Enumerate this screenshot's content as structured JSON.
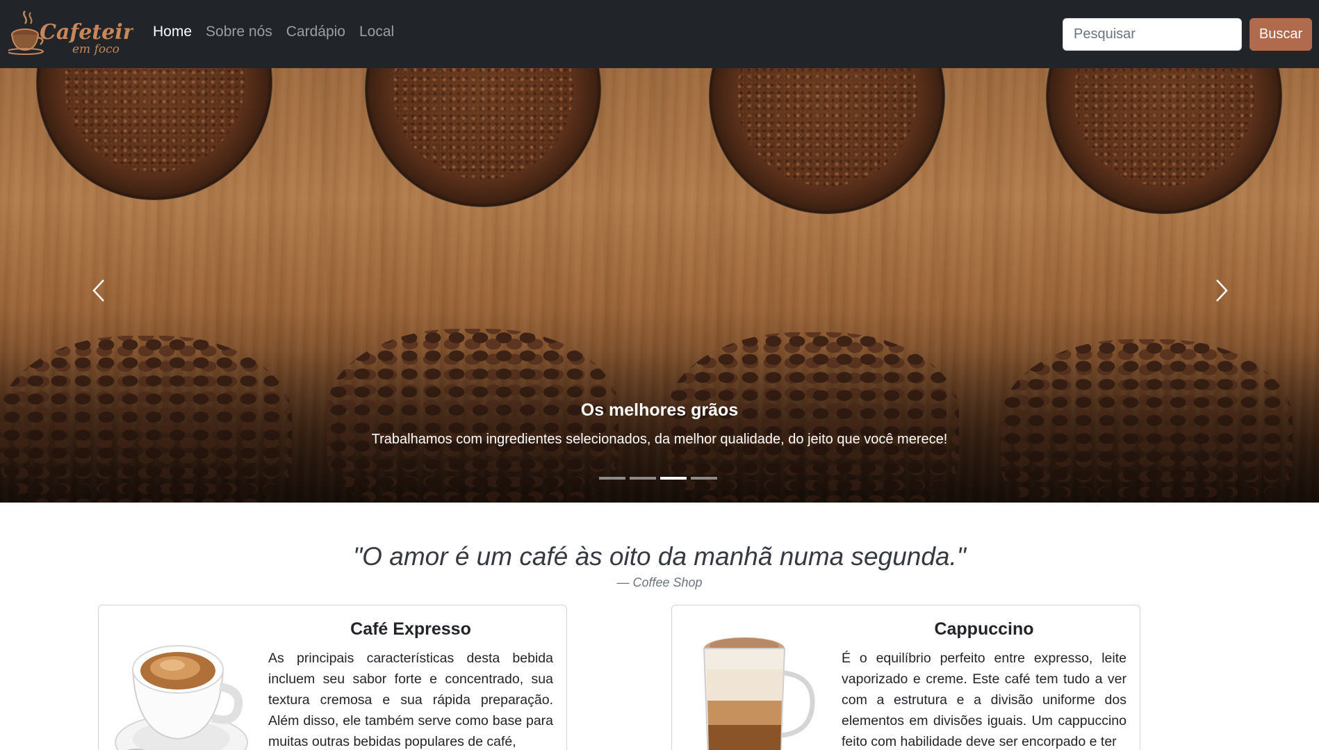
{
  "navbar": {
    "brand": {
      "name": "Cafeteira",
      "tagline": "em foco"
    },
    "links": [
      {
        "label": "Home",
        "active": true
      },
      {
        "label": "Sobre nós",
        "active": false
      },
      {
        "label": "Cardápio",
        "active": false
      },
      {
        "label": "Local",
        "active": false
      }
    ],
    "search": {
      "placeholder": "Pesquisar",
      "value": ""
    },
    "search_button": "Buscar"
  },
  "carousel": {
    "caption_title": "Os melhores grãos",
    "caption_text": "Trabalhamos com ingredientes selecionados, da melhor qualidade, do jeito que você merece!",
    "prev_icon": "chevron-left-icon",
    "next_icon": "chevron-right-icon",
    "slide_count": 4,
    "active_slide": 3
  },
  "quote": {
    "text": "\"O amor é um café às oito da manhã numa segunda.\"",
    "source": "—  Coffee Shop"
  },
  "cards": [
    {
      "title": "Café Expresso",
      "text": " As principais características desta bebida incluem seu sabor forte e concentrado, sua textura cremosa e sua rápida preparação. Além disso, ele também serve como base para muitas outras bebidas populares de café,",
      "image": "espresso-cup-image"
    },
    {
      "title": "Cappuccino",
      "text": " É o equilíbrio perfeito entre expresso, leite vaporizado e creme. Este café tem tudo a ver com a estrutura e a divisão uniforme dos elementos em divisões iguais. Um cappuccino feito com habilidade deve ser encorpado e ter",
      "image": "cappuccino-glass-image"
    }
  ],
  "colors": {
    "navbar_bg": "#212529",
    "accent": "#b06a4e",
    "brand": "#c8875a"
  }
}
